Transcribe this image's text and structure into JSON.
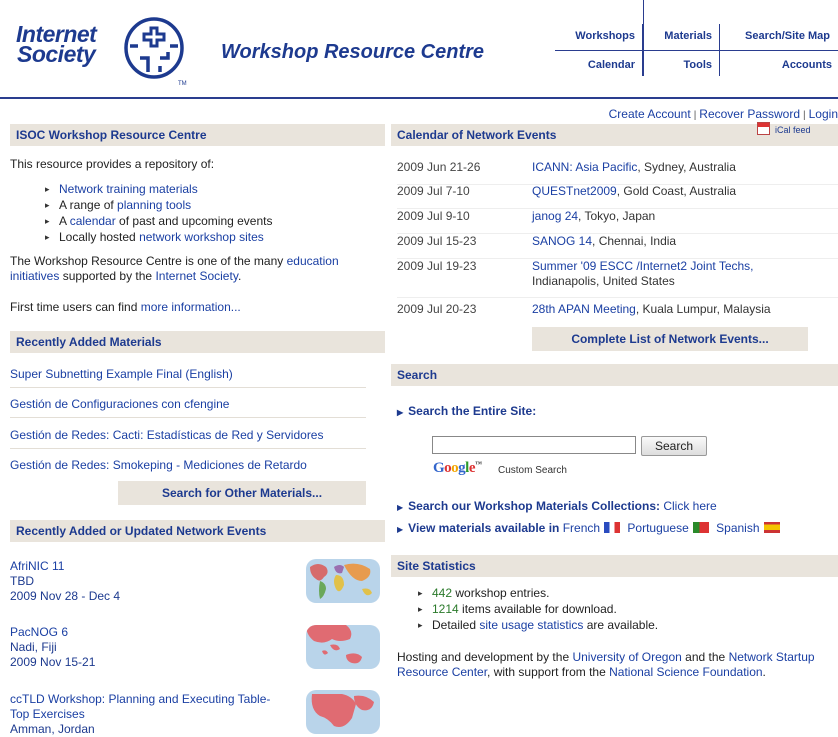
{
  "header": {
    "logo_line1": "Internet",
    "logo_line2": "Society",
    "logo_tm": "TM",
    "site_title": "Workshop Resource Centre",
    "nav": {
      "workshops": "Workshops",
      "materials": "Materials",
      "search_site_map": "Search/Site Map",
      "calendar": "Calendar",
      "tools": "Tools",
      "accounts": "Accounts"
    }
  },
  "account_links": {
    "create": "Create Account",
    "recover": "Recover Password",
    "login": "Login",
    "separator": "|"
  },
  "intro": {
    "heading": "ISOC Workshop Resource Centre",
    "lead": "This resource provides a repository of:",
    "items": [
      {
        "pre": "",
        "link": "Network training materials",
        "post": ""
      },
      {
        "pre": "A range of ",
        "link": "planning tools",
        "post": ""
      },
      {
        "pre": "A ",
        "link": "calendar",
        "post": " of past and upcoming events"
      },
      {
        "pre": "Locally hosted ",
        "link": "network workshop sites",
        "post": ""
      }
    ],
    "para1_pre": "The Workshop Resource Centre is one of the many ",
    "para1_link1": "education initiatives",
    "para1_mid": " supported by the ",
    "para1_link2": "Internet Society",
    "para1_post": ".",
    "para2_pre": "First time users can find ",
    "para2_link": "more information...",
    "para2_post": ""
  },
  "recent_materials": {
    "heading": "Recently Added Materials",
    "items": [
      "Super Subnetting Example Final (English)",
      "Gestión de Configuraciones con cfengine",
      "Gestión de Redes: Cacti: Estadísticas de Red y Servidores",
      "Gestión de Redes: Smokeping - Mediciones de Retardo"
    ],
    "button": "Search for Other Materials..."
  },
  "recent_events": {
    "heading": "Recently Added or Updated Network Events",
    "items": [
      {
        "name": "AfriNIC 11",
        "location": "TBD",
        "dates": "2009 Nov 28 - Dec 4",
        "map_icon": "world-map-icon"
      },
      {
        "name": "PacNOG 6",
        "location": "Nadi, Fiji",
        "dates": "2009 Nov 15-21",
        "map_icon": "asia-pacific-map-icon"
      },
      {
        "name": "ccTLD Workshop: Planning and Executing Table-",
        "name2": "Top Exercises",
        "location": "Amman, Jordan",
        "dates": "",
        "map_icon": "middle-east-map-icon"
      }
    ]
  },
  "calendar": {
    "heading": "Calendar of Network Events",
    "ical": "iCal feed",
    "rows": [
      {
        "date": "2009 Jun 21-26",
        "link": "ICANN: Asia Pacific",
        "rest": ", Sydney, Australia"
      },
      {
        "date": "2009 Jul 7-10",
        "link": "QUESTnet2009",
        "rest": ", Gold Coast, Australia"
      },
      {
        "date": "2009 Jul 9-10",
        "link": "janog 24",
        "rest": ", Tokyo, Japan"
      },
      {
        "date": "2009 Jul 15-23",
        "link": "SANOG 14",
        "rest": ", Chennai, India"
      },
      {
        "date": "2009 Jul 19-23",
        "link": "Summer '09 ESCC /Internet2 Joint Techs,",
        "rest": "Indianapolis, United States"
      },
      {
        "date": "2009 Jul 20-23",
        "link": "28th APAN Meeting",
        "rest": ", Kuala Lumpur, Malaysia"
      }
    ],
    "complete_list": "Complete List of Network Events..."
  },
  "search": {
    "heading": "Search",
    "entire_site": "Search the Entire Site:",
    "input_value": "",
    "button": "Search",
    "google_cse": "Custom Search",
    "google_tm": "™",
    "collections_pre": "Search our Workshop Materials Collections:",
    "collections_link": "Click here",
    "langs_pre": "View materials available in",
    "lang_french": "French",
    "lang_portuguese": "Portuguese",
    "lang_spanish": "Spanish"
  },
  "stats": {
    "heading": "Site Statistics",
    "entries_count": "442",
    "entries_text": " workshop entries.",
    "items_count": "1214",
    "items_text": " items available for download.",
    "detail_pre": "Detailed ",
    "detail_link": "site usage statistics",
    "detail_post": " are available.",
    "hosting_pre": "Hosting and development by the ",
    "hosting_link1": "University of Oregon",
    "hosting_mid1": " and the ",
    "hosting_link2": "Network Startup Resource Center",
    "hosting_mid2": ", with support from the ",
    "hosting_link3": "National Science Foundation",
    "hosting_post": "."
  },
  "colors": {
    "brand": "#1d3a8f",
    "link": "#1a3fa3",
    "section_bg": "#e9e4dc",
    "count_green": "#2b7a2b"
  }
}
